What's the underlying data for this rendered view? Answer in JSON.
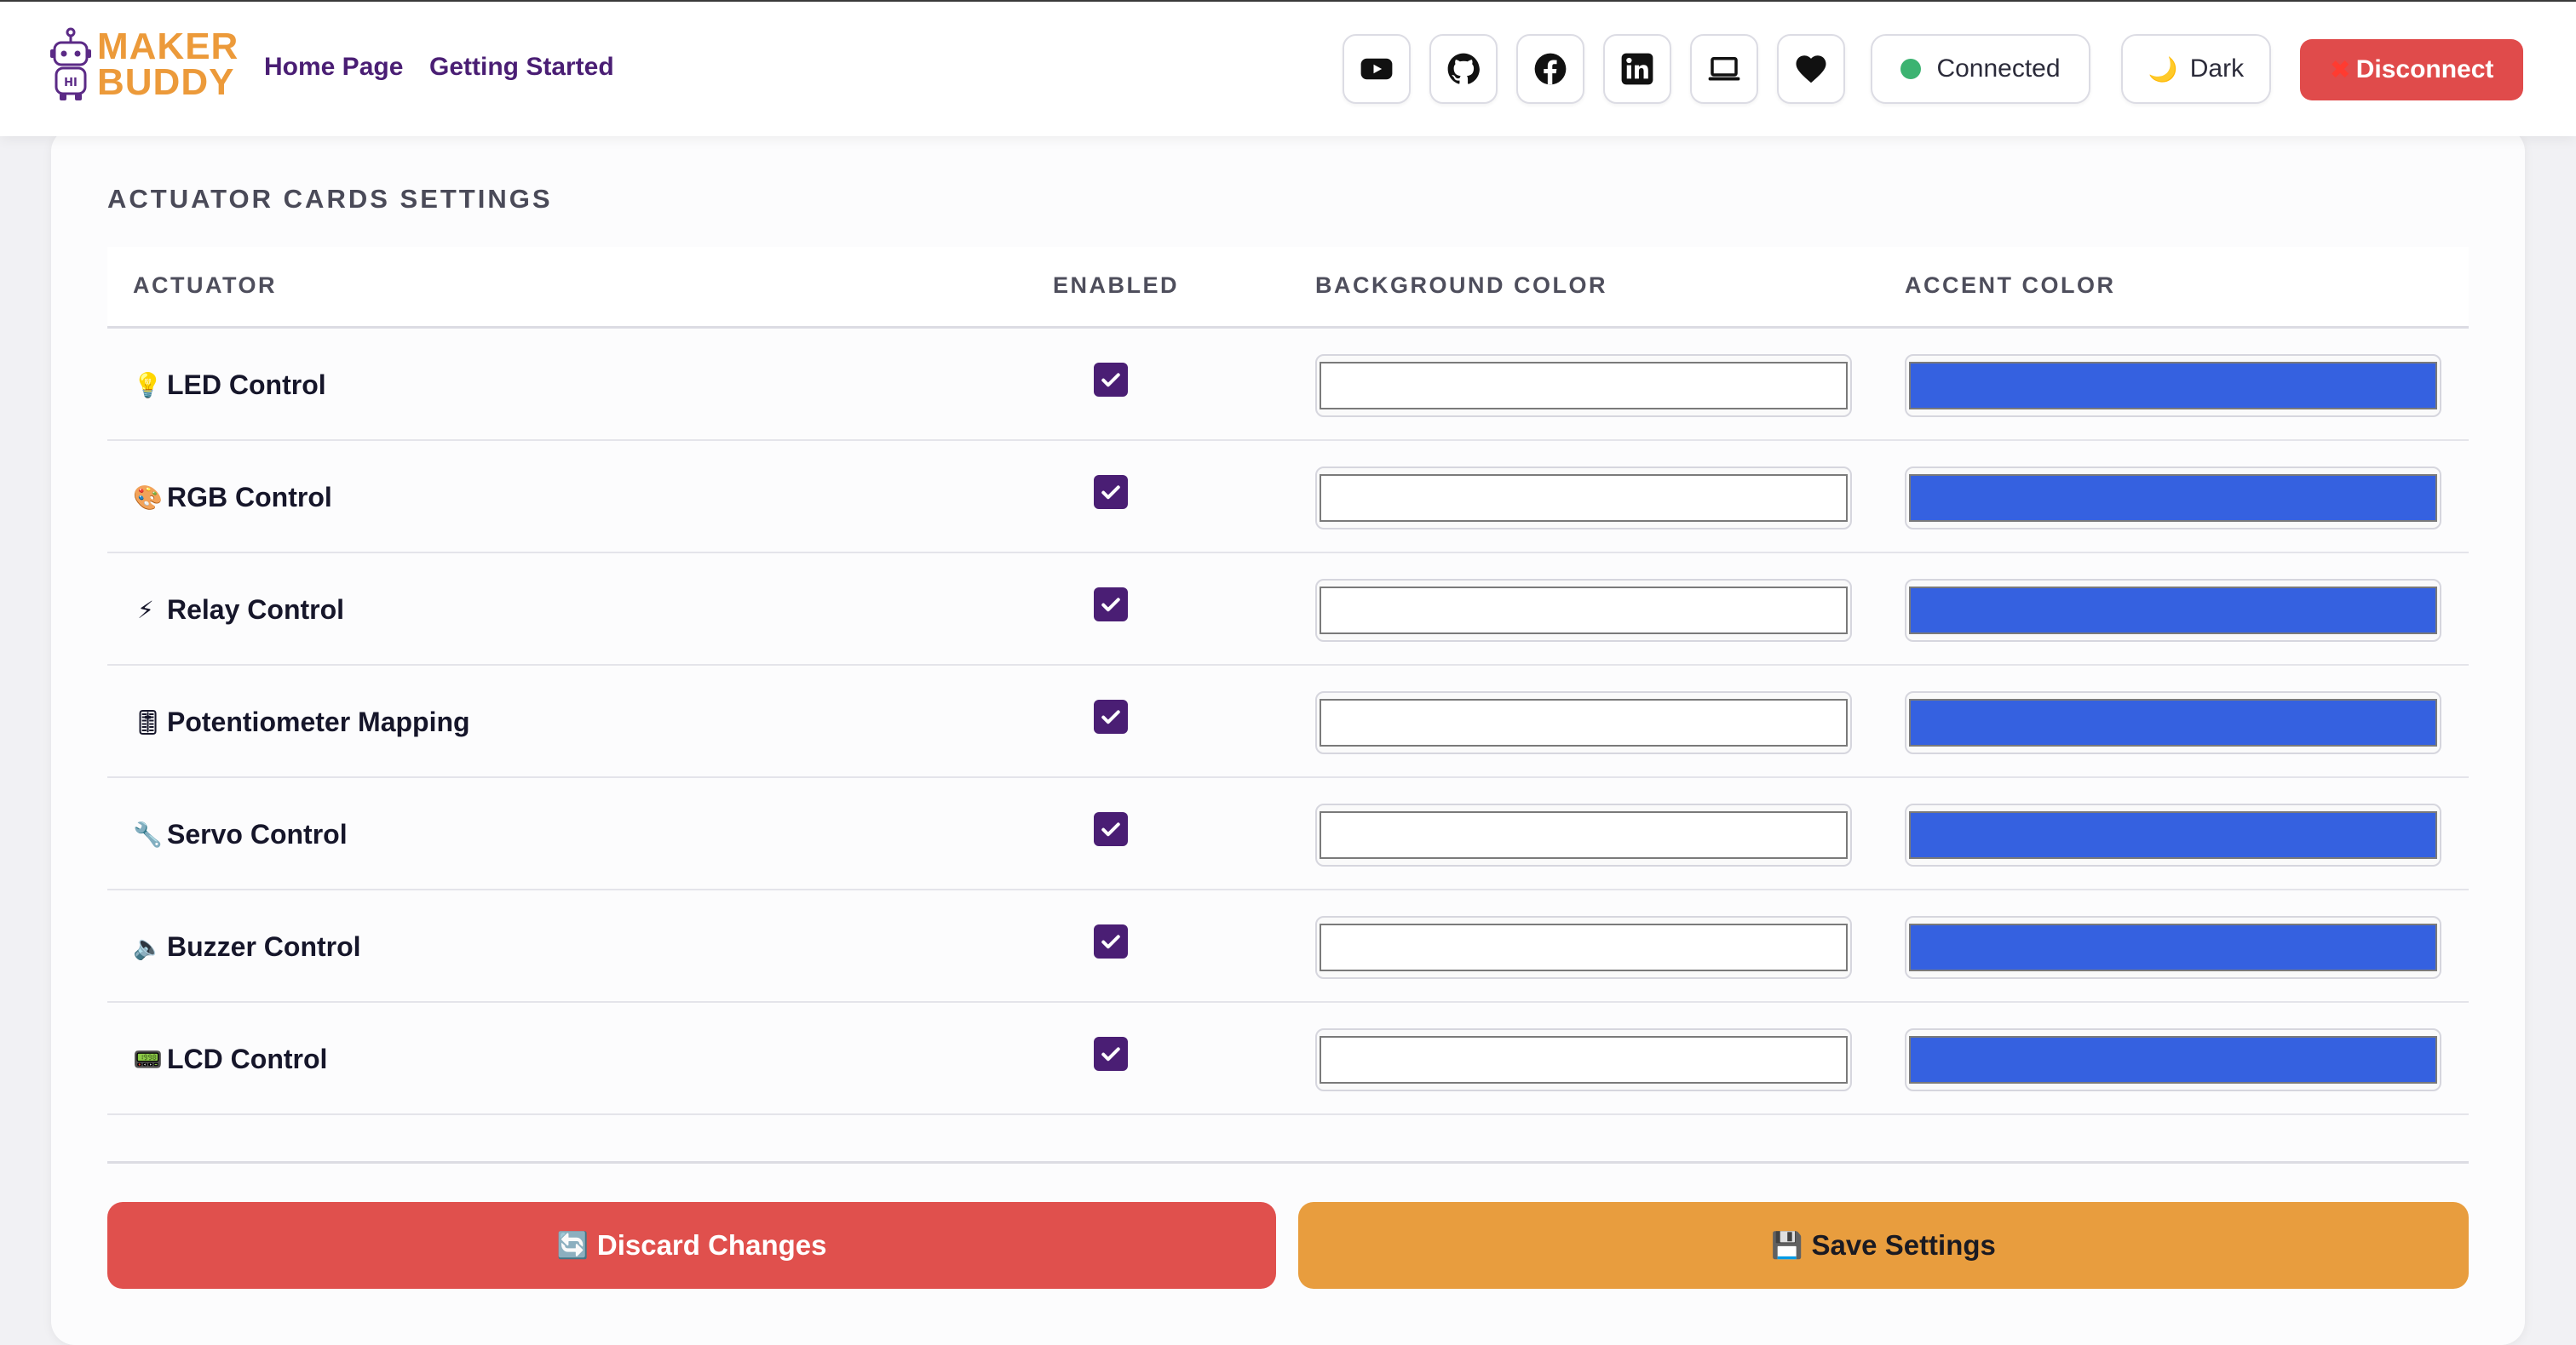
{
  "header": {
    "logo_line1": "MAKER",
    "logo_line2": "BUDDY",
    "nav": [
      {
        "label": "Home Page"
      },
      {
        "label": "Getting Started"
      }
    ],
    "icons": [
      "youtube-icon",
      "github-icon",
      "facebook-icon",
      "linkedin-icon",
      "laptop-icon",
      "heart-icon"
    ],
    "status_label": "Connected",
    "status_color": "#3cb371",
    "theme_label": "Dark",
    "theme_icon": "🌙",
    "disconnect_icon": "✖",
    "disconnect_label": "Disconnect"
  },
  "settings": {
    "title": "ACTUATOR CARDS SETTINGS",
    "columns": {
      "actuator": "ACTUATOR",
      "enabled": "ENABLED",
      "background": "BACKGROUND COLOR",
      "accent": "ACCENT COLOR"
    },
    "rows": [
      {
        "icon": "💡",
        "name": "LED Control",
        "enabled": true,
        "background": "#ffffff",
        "accent": "#3561e0"
      },
      {
        "icon": "🎨",
        "name": "RGB Control",
        "enabled": true,
        "background": "#ffffff",
        "accent": "#3561e0"
      },
      {
        "icon": "⚡",
        "name": "Relay Control",
        "enabled": true,
        "background": "#ffffff",
        "accent": "#3561e0"
      },
      {
        "icon": "🎚",
        "name": "Potentiometer Mapping",
        "enabled": true,
        "background": "#ffffff",
        "accent": "#3561e0"
      },
      {
        "icon": "🔧",
        "name": "Servo Control",
        "enabled": true,
        "background": "#ffffff",
        "accent": "#3561e0"
      },
      {
        "icon": "🔈",
        "name": "Buzzer Control",
        "enabled": true,
        "background": "#ffffff",
        "accent": "#3561e0"
      },
      {
        "icon": "📟",
        "name": "LCD Control",
        "enabled": true,
        "background": "#ffffff",
        "accent": "#3561e0"
      }
    ]
  },
  "actions": {
    "discard_icon": "🔄",
    "discard_label": "Discard Changes",
    "save_icon": "💾",
    "save_label": "Save Settings"
  },
  "colors": {
    "brand_orange": "#ec9a3a",
    "brand_purple": "#4a1e74",
    "danger": "#e0504d",
    "save": "#e89d3e"
  }
}
